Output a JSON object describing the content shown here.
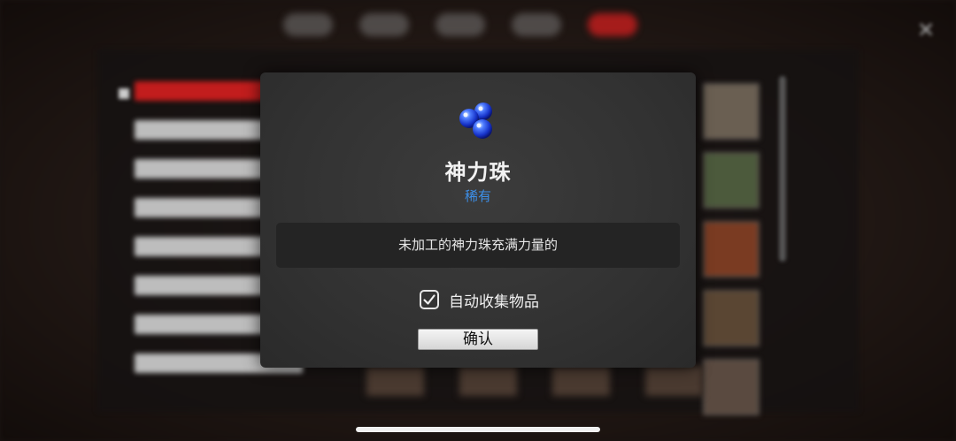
{
  "background": {
    "close_icon": "close-icon"
  },
  "dialog": {
    "item_icon": "blue-orbs-icon",
    "item_name": "神力珠",
    "rarity": "稀有",
    "rarity_color": "#3d8fe8",
    "description": "未加工的神力珠充满力量的",
    "auto_collect": {
      "label": "自动收集物品",
      "checked": true
    },
    "confirm_label": "确认"
  }
}
